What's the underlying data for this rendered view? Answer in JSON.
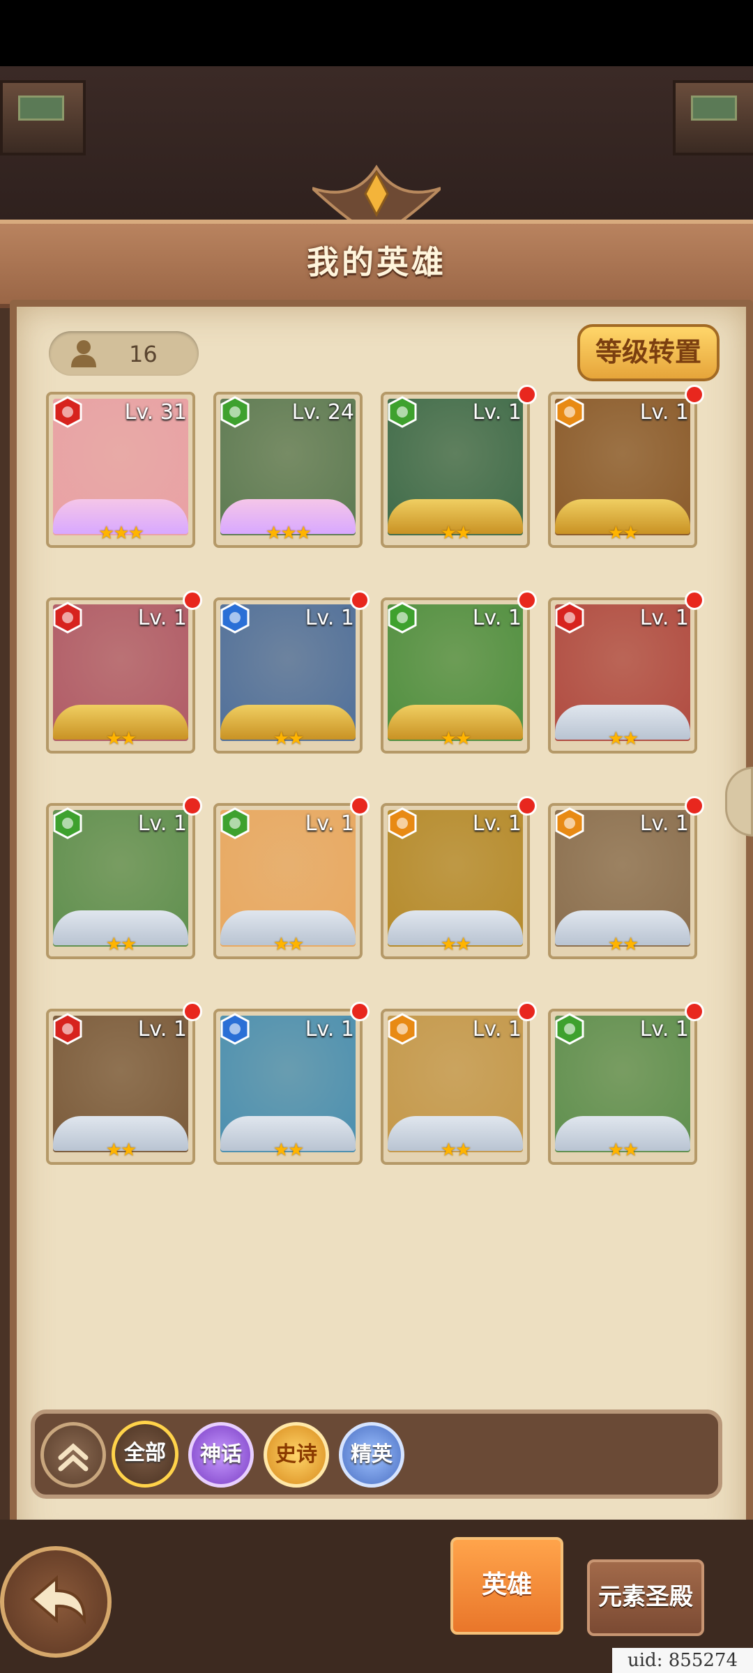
{
  "header": {
    "title": "我的英雄"
  },
  "hero_count": "16",
  "reset_button": "等级转置",
  "heroes": [
    {
      "level": "Lv. 31",
      "stars": "★★★",
      "element": "fire"
    },
    {
      "level": "Lv. 24",
      "stars": "★★★",
      "element": "wind"
    },
    {
      "level": "Lv. 1",
      "stars": "★★",
      "element": "wind"
    },
    {
      "level": "Lv. 1",
      "stars": "★★",
      "element": "earth"
    },
    {
      "level": "Lv. 1",
      "stars": "★★",
      "element": "fire"
    },
    {
      "level": "Lv. 1",
      "stars": "★★",
      "element": "water"
    },
    {
      "level": "Lv. 1",
      "stars": "★★",
      "element": "wind"
    },
    {
      "level": "Lv. 1",
      "stars": "★★",
      "element": "fire"
    },
    {
      "level": "Lv. 1",
      "stars": "★★",
      "element": "wind"
    },
    {
      "level": "Lv. 1",
      "stars": "★★",
      "element": "wind"
    },
    {
      "level": "Lv. 1",
      "stars": "★★",
      "element": "earth"
    },
    {
      "level": "Lv. 1",
      "stars": "★★",
      "element": "earth"
    },
    {
      "level": "Lv. 1",
      "stars": "★★",
      "element": "fire"
    },
    {
      "level": "Lv. 1",
      "stars": "★★",
      "element": "water"
    },
    {
      "level": "Lv. 1",
      "stars": "★★",
      "element": "earth"
    },
    {
      "level": "Lv. 1",
      "stars": "★★",
      "element": "wind"
    }
  ],
  "filters": {
    "all": "全部",
    "myth": "神话",
    "epic": "史诗",
    "elite": "精英"
  },
  "tabs": {
    "hero": "英雄",
    "element_temple": "元素圣殿"
  },
  "uid": "uid: 855274"
}
